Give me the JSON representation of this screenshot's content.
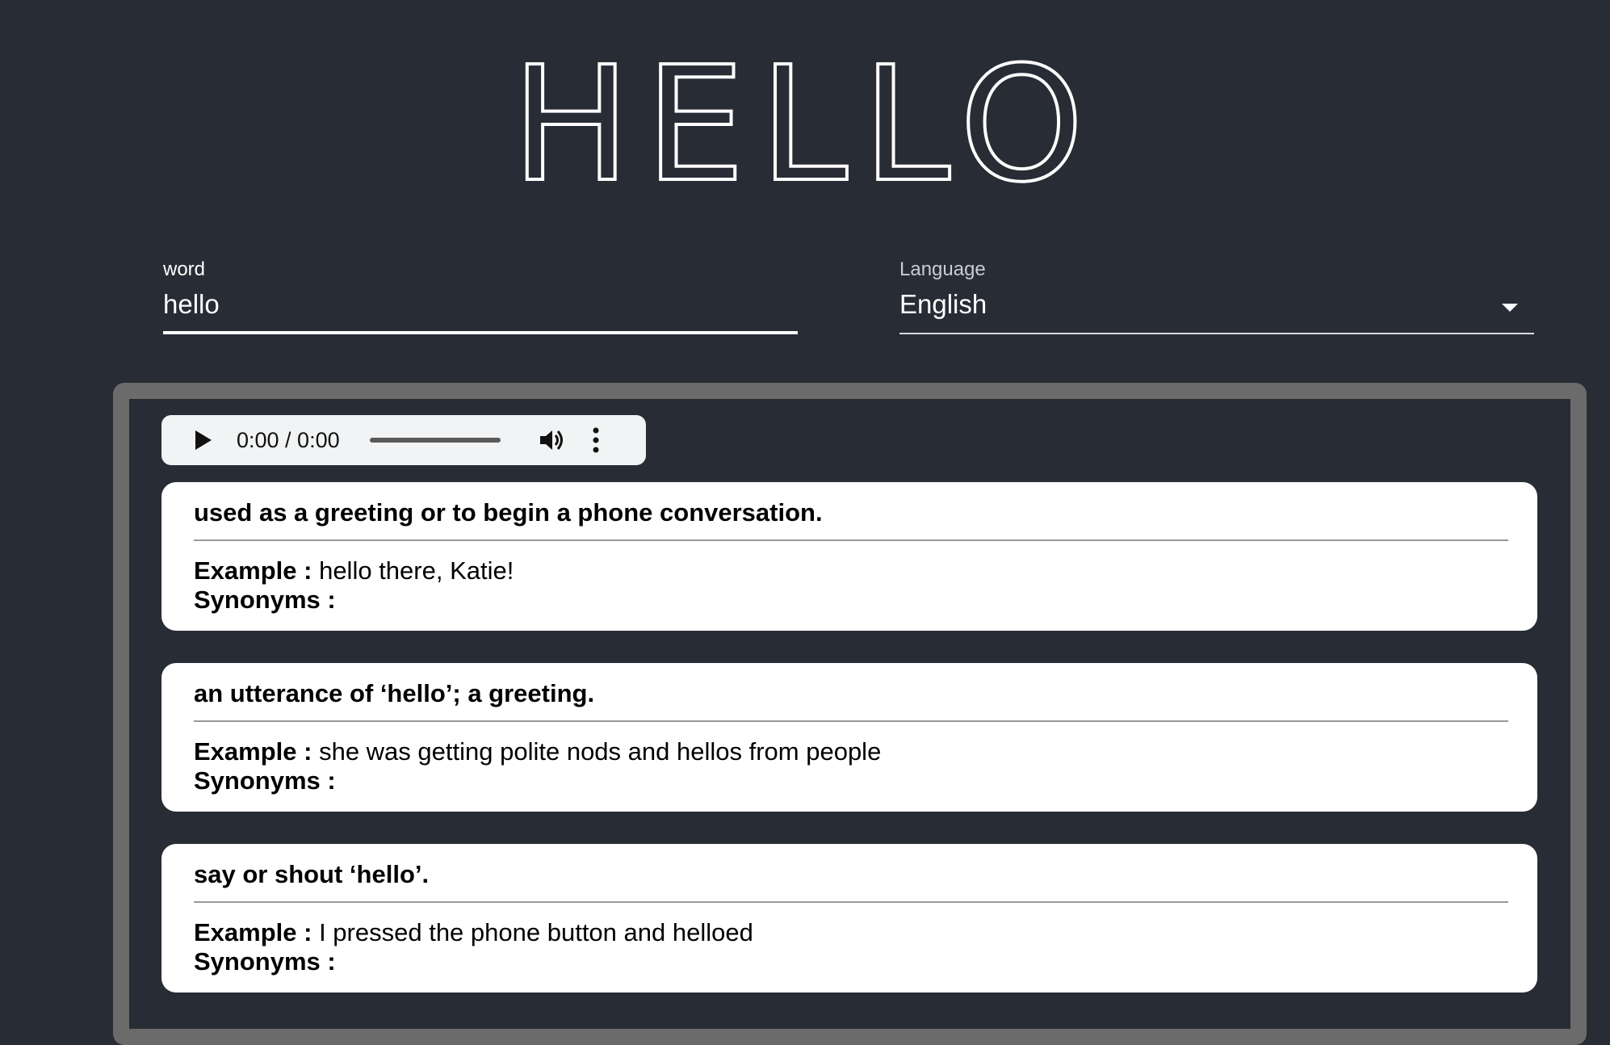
{
  "title": "HELLO",
  "word_field": {
    "label": "word",
    "value": "hello"
  },
  "language_field": {
    "label": "Language",
    "value": "English",
    "icon": "caret-down-icon"
  },
  "audio_player": {
    "time": "0:00 / 0:00",
    "progress": 0,
    "icons": [
      "play-icon",
      "volume-icon",
      "more-vertical-icon"
    ]
  },
  "meanings": [
    {
      "definition": "used as a greeting or to begin a phone conversation.",
      "example_label": "Example :",
      "example": "hello there, Katie!",
      "synonyms_label": "Synonyms :",
      "synonyms": ""
    },
    {
      "definition": "an utterance of ‘hello’; a greeting.",
      "example_label": "Example :",
      "example": "she was getting polite nods and hellos from people",
      "synonyms_label": "Synonyms :",
      "synonyms": ""
    },
    {
      "definition": "say or shout ‘hello’.",
      "example_label": "Example :",
      "example": "I pressed the phone button and helloed",
      "synonyms_label": "Synonyms :",
      "synonyms": ""
    }
  ],
  "colors": {
    "background": "#282c34",
    "panel_border": "#6b6b6b",
    "card": "#ffffff",
    "audio_bg": "#f1f3f4"
  }
}
